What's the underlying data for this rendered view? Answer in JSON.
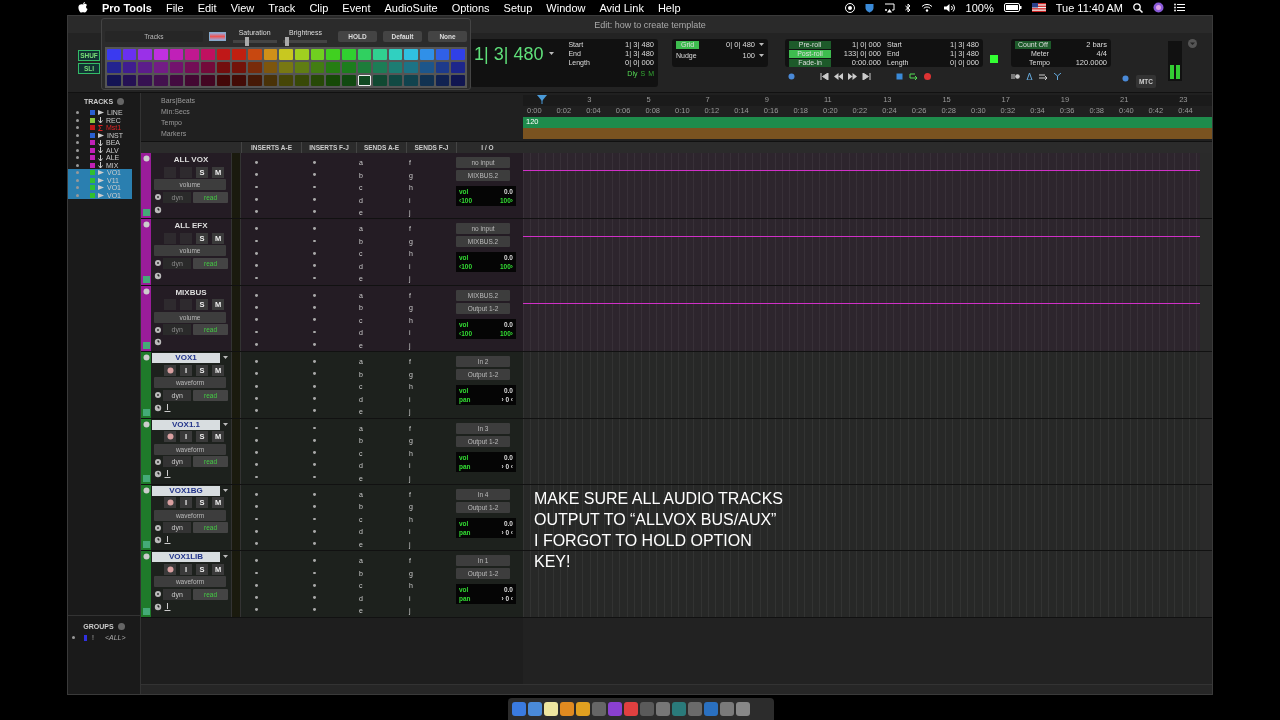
{
  "menubar": {
    "app": "Pro Tools",
    "menus": [
      "File",
      "Edit",
      "View",
      "Track",
      "Clip",
      "Event",
      "AudioSuite",
      "Options",
      "Setup",
      "Window",
      "Avid Link",
      "Help"
    ],
    "battery": "100%",
    "clock": "Tue 11:40 AM"
  },
  "window": {
    "title": "Edit: how to create template"
  },
  "edit_modes": [
    "SHUF",
    "SLI"
  ],
  "color_palette": {
    "target": "Tracks",
    "saturation_label": "Saturation",
    "brightness_label": "Brightness",
    "saturation": {
      "level": 0.3
    },
    "brightness": {
      "level": 0.05
    },
    "buttons": [
      "HOLD",
      "Default",
      "None"
    ],
    "swatch_rows": [
      {
        "swatches": [
          {
            "color": "#3a3af0",
            "selected": false
          },
          {
            "color": "#6a30f0",
            "selected": false
          },
          {
            "color": "#9a30e8",
            "selected": false
          },
          {
            "color": "#c030e0",
            "selected": false
          },
          {
            "color": "#c020b8",
            "selected": false
          },
          {
            "color": "#c01890",
            "selected": false
          },
          {
            "color": "#c01060",
            "selected": false
          },
          {
            "color": "#c01818",
            "selected": false
          },
          {
            "color": "#c02010",
            "selected": false
          },
          {
            "color": "#c84810",
            "selected": false
          },
          {
            "color": "#d09018",
            "selected": false
          },
          {
            "color": "#c8c820",
            "selected": false
          },
          {
            "color": "#a0d020",
            "selected": false
          },
          {
            "color": "#70d020",
            "selected": false
          },
          {
            "color": "#40d020",
            "selected": false
          },
          {
            "color": "#30d030",
            "selected": false
          },
          {
            "color": "#30d060",
            "selected": false
          },
          {
            "color": "#30d090",
            "selected": false
          },
          {
            "color": "#30d0c0",
            "selected": false
          },
          {
            "color": "#30c0e0",
            "selected": false
          },
          {
            "color": "#3090e8",
            "selected": false
          },
          {
            "color": "#3060e8",
            "selected": false
          },
          {
            "color": "#3040e8",
            "selected": false
          }
        ]
      },
      {
        "swatches": [
          {
            "color": "#232390",
            "selected": false
          },
          {
            "color": "#401d90",
            "selected": false
          },
          {
            "color": "#5c1d8b",
            "selected": false
          },
          {
            "color": "#731d86",
            "selected": false
          },
          {
            "color": "#73136e",
            "selected": false
          },
          {
            "color": "#730e56",
            "selected": false
          },
          {
            "color": "#730a3a",
            "selected": false
          },
          {
            "color": "#730e0e",
            "selected": false
          },
          {
            "color": "#73130a",
            "selected": false
          },
          {
            "color": "#782b0a",
            "selected": false
          },
          {
            "color": "#7d560e",
            "selected": false
          },
          {
            "color": "#787813",
            "selected": false
          },
          {
            "color": "#607d13",
            "selected": false
          },
          {
            "color": "#437d13",
            "selected": false
          },
          {
            "color": "#267d13",
            "selected": false
          },
          {
            "color": "#1d7d1d",
            "selected": false
          },
          {
            "color": "#1d7d3a",
            "selected": false
          },
          {
            "color": "#1d7d56",
            "selected": false
          },
          {
            "color": "#1d7d73",
            "selected": false
          },
          {
            "color": "#1d7386",
            "selected": false
          },
          {
            "color": "#1d568b",
            "selected": false
          },
          {
            "color": "#1d3a8b",
            "selected": false
          },
          {
            "color": "#1d268b",
            "selected": false
          }
        ]
      },
      {
        "swatches": [
          {
            "color": "#141454",
            "selected": false
          },
          {
            "color": "#251154",
            "selected": false
          },
          {
            "color": "#361151",
            "selected": false
          },
          {
            "color": "#43114e",
            "selected": false
          },
          {
            "color": "#430b40",
            "selected": false
          },
          {
            "color": "#430832",
            "selected": false
          },
          {
            "color": "#430622",
            "selected": false
          },
          {
            "color": "#430808",
            "selected": false
          },
          {
            "color": "#430b06",
            "selected": false
          },
          {
            "color": "#461906",
            "selected": false
          },
          {
            "color": "#493208",
            "selected": false
          },
          {
            "color": "#464607",
            "selected": false
          },
          {
            "color": "#384907",
            "selected": false
          },
          {
            "color": "#274907",
            "selected": false
          },
          {
            "color": "#164907",
            "selected": false
          },
          {
            "color": "#114911",
            "selected": false
          },
          {
            "color": "#114922",
            "selected": true
          },
          {
            "color": "#114932",
            "selected": false
          },
          {
            "color": "#114943",
            "selected": false
          },
          {
            "color": "#11434e",
            "selected": false
          },
          {
            "color": "#113251",
            "selected": false
          },
          {
            "color": "#112251",
            "selected": false
          },
          {
            "color": "#111651",
            "selected": false
          }
        ]
      }
    ]
  },
  "counter": {
    "main": "1| 3| 480",
    "fields": [
      {
        "label": "Start",
        "value": "1| 3| 480"
      },
      {
        "label": "End",
        "value": "1| 3| 480"
      },
      {
        "label": "Length",
        "value": "0| 0| 000"
      }
    ],
    "dly": "Dly",
    "solo": "S",
    "mute": "M"
  },
  "grid": {
    "label": "Grid",
    "value": "0| 0| 480",
    "nudge_label": "Nudge",
    "nudge_value": "100"
  },
  "rolls": [
    {
      "label": "Pre-roll",
      "value": "1| 0| 000",
      "on": false
    },
    {
      "label": "Post-roll",
      "value": "133| 0| 000",
      "on": true
    },
    {
      "label": "Fade-in",
      "value": "0:00.000",
      "on": false
    }
  ],
  "selection": [
    {
      "label": "Start",
      "value": "1| 3| 480"
    },
    {
      "label": "End",
      "value": "1| 3| 480"
    },
    {
      "label": "Length",
      "value": "0| 0| 000"
    }
  ],
  "tempo": {
    "count_off": "Count Off",
    "count_off_value": "2 bars",
    "meter_label": "Meter",
    "meter_value": "4/4",
    "tempo_label": "Tempo",
    "tempo_value": "120.0000"
  },
  "sync": "MTC",
  "tracks_list": {
    "title": "TRACKS",
    "items": [
      {
        "name": "LINE",
        "kind": "instrument",
        "color": "#2a5fd0",
        "selected": false
      },
      {
        "name": "REC",
        "kind": "audio",
        "color": "#8cc63e",
        "selected": false
      },
      {
        "name": "Mst1",
        "kind": "master",
        "color": "#c01818",
        "selected": false
      },
      {
        "name": "INST",
        "kind": "instrument",
        "color": "#2a5fd0",
        "selected": false
      },
      {
        "name": "BEA",
        "kind": "audio",
        "color": "#c020b8",
        "selected": false
      },
      {
        "name": "ALV",
        "kind": "audio",
        "color": "#c020b8",
        "selected": false
      },
      {
        "name": "ALE",
        "kind": "audio",
        "color": "#c020b8",
        "selected": false
      },
      {
        "name": "MIX",
        "kind": "audio",
        "color": "#c020b8",
        "selected": false
      },
      {
        "name": "VO1",
        "kind": "instrument",
        "color": "#30c030",
        "selected": true
      },
      {
        "name": "V11",
        "kind": "instrument",
        "color": "#30c030",
        "selected": true
      },
      {
        "name": "VO1",
        "kind": "instrument",
        "color": "#30c030",
        "selected": true
      },
      {
        "name": "VO1",
        "kind": "instrument",
        "color": "#30c030",
        "selected": true
      }
    ]
  },
  "rulers": {
    "rows": [
      "Bars|Beats",
      "Min:Secs",
      "Tempo",
      "Markers"
    ],
    "bars": [
      "3",
      "5",
      "7",
      "9",
      "11",
      "13",
      "15",
      "17",
      "19",
      "21",
      "23"
    ],
    "times": [
      "0:00",
      "0:02",
      "0:04",
      "0:06",
      "0:08",
      "0:10",
      "0:12",
      "0:14",
      "0:16",
      "0:18",
      "0:20",
      "0:22",
      "0:24",
      "0:26",
      "0:28",
      "0:30",
      "0:32",
      "0:34",
      "0:36",
      "0:38",
      "0:40",
      "0:42",
      "0:44"
    ],
    "tempo_marker": "120"
  },
  "columns": [
    "INSERTS A-E",
    "INSERTS F-J",
    "SENDS A-E",
    "SENDS F-J",
    "I / O"
  ],
  "tracks": [
    {
      "name": "ALL VOX",
      "kind": "aux",
      "solo": "S",
      "mute": "M",
      "color": "#9a1c9a",
      "input": "no input",
      "output": "MIXBUS.2",
      "view": "volume",
      "dyn": "dyn",
      "automation": "read",
      "vol_label": "vol",
      "vol": "0.0",
      "pan_left": "‹100",
      "pan_right": "100›",
      "sends_ae": [
        "a",
        "b",
        "c",
        "d",
        "e"
      ],
      "sends_fj": [
        "f",
        "g",
        "h",
        "i",
        "j"
      ]
    },
    {
      "name": "ALL EFX",
      "kind": "aux",
      "solo": "S",
      "mute": "M",
      "color": "#9a1c9a",
      "input": "no input",
      "output": "MIXBUS.2",
      "view": "volume",
      "dyn": "dyn",
      "automation": "read",
      "vol_label": "vol",
      "vol": "0.0",
      "pan_left": "‹100",
      "pan_right": "100›",
      "sends_ae": [
        "a",
        "b",
        "c",
        "d",
        "e"
      ],
      "sends_fj": [
        "f",
        "g",
        "h",
        "i",
        "j"
      ]
    },
    {
      "name": "MIXBUS",
      "kind": "aux",
      "solo": "S",
      "mute": "M",
      "color": "#9a1c9a",
      "input": "MIXBUS.2",
      "output": "Output 1-2",
      "view": "volume",
      "dyn": "dyn",
      "automation": "read",
      "vol_label": "vol",
      "vol": "0.0",
      "pan_left": "‹100",
      "pan_right": "100›",
      "sends_ae": [
        "a",
        "b",
        "c",
        "d",
        "e"
      ],
      "sends_fj": [
        "f",
        "g",
        "h",
        "i",
        "j"
      ]
    },
    {
      "name": "VOX1",
      "kind": "audio",
      "input_monitor": "I",
      "solo": "S",
      "mute": "M",
      "color": "#1f7a2a",
      "input": "In 2",
      "output": "Output 1-2",
      "view": "waveform",
      "dyn": "dyn",
      "automation": "read",
      "vol_label": "vol",
      "vol": "0.0",
      "pan_label": "pan",
      "pan": "› 0 ‹",
      "sends_ae": [
        "a",
        "b",
        "c",
        "d",
        "e"
      ],
      "sends_fj": [
        "f",
        "g",
        "h",
        "i",
        "j"
      ]
    },
    {
      "name": "VOX1.1",
      "kind": "audio",
      "input_monitor": "I",
      "solo": "S",
      "mute": "M",
      "color": "#1f7a2a",
      "input": "In 3",
      "output": "Output 1-2",
      "view": "waveform",
      "dyn": "dyn",
      "automation": "read",
      "vol_label": "vol",
      "vol": "0.0",
      "pan_label": "pan",
      "pan": "› 0 ‹",
      "sends_ae": [
        "a",
        "b",
        "c",
        "d",
        "e"
      ],
      "sends_fj": [
        "f",
        "g",
        "h",
        "i",
        "j"
      ]
    },
    {
      "name": "VOX1BG",
      "kind": "audio",
      "input_monitor": "I",
      "solo": "S",
      "mute": "M",
      "color": "#1f7a2a",
      "input": "In 4",
      "output": "Output 1-2",
      "view": "waveform",
      "dyn": "dyn",
      "automation": "read",
      "vol_label": "vol",
      "vol": "0.0",
      "pan_label": "pan",
      "pan": "› 0 ‹",
      "sends_ae": [
        "a",
        "b",
        "c",
        "d",
        "e"
      ],
      "sends_fj": [
        "f",
        "g",
        "h",
        "i",
        "j"
      ]
    },
    {
      "name": "VOX1LIB",
      "kind": "audio",
      "input_monitor": "I",
      "solo": "S",
      "mute": "M",
      "color": "#1f7a2a",
      "input": "In 1",
      "output": "Output 1-2",
      "view": "waveform",
      "dyn": "dyn",
      "automation": "read",
      "vol_label": "vol",
      "vol": "0.0",
      "pan_label": "pan",
      "pan": "› 0 ‹",
      "sends_ae": [
        "a",
        "b",
        "c",
        "d",
        "e"
      ],
      "sends_fj": [
        "f",
        "g",
        "h",
        "i",
        "j"
      ]
    }
  ],
  "annotation": {
    "lines": [
      "MAKE SURE ALL AUDIO TRACKS",
      "OUTPUT TO “ALLVOX BUS/AUX”",
      "I FORGOT TO HOLD OPTION",
      "KEY!"
    ]
  },
  "groups": {
    "title": "GROUPS",
    "items": [
      {
        "mark": "!",
        "name": "<ALL>",
        "color": "#3030e0"
      }
    ]
  }
}
